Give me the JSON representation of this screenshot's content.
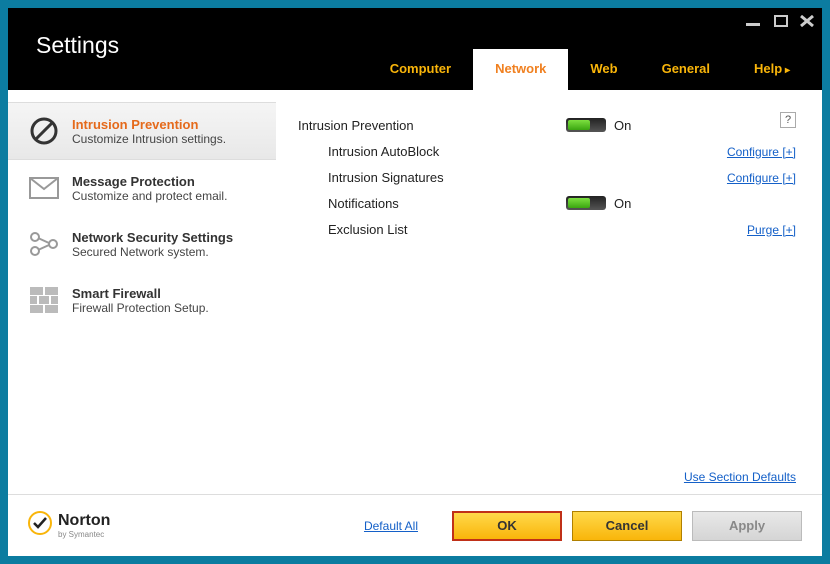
{
  "title": "Settings",
  "tabs": [
    {
      "label": "Computer",
      "active": false
    },
    {
      "label": "Network",
      "active": true
    },
    {
      "label": "Web",
      "active": false
    },
    {
      "label": "General",
      "active": false
    },
    {
      "label": "Help",
      "active": false,
      "help": true
    }
  ],
  "sidebar": [
    {
      "title": "Intrusion Prevention",
      "desc": "Customize Intrusion settings.",
      "icon": "block-icon",
      "active": true
    },
    {
      "title": "Message Protection",
      "desc": "Customize and protect email.",
      "icon": "envelope-icon",
      "active": false
    },
    {
      "title": "Network Security Settings",
      "desc": "Secured Network system.",
      "icon": "network-icon",
      "active": false
    },
    {
      "title": "Smart Firewall",
      "desc": "Firewall Protection Setup.",
      "icon": "firewall-icon",
      "active": false
    }
  ],
  "settings": [
    {
      "label": "Intrusion Prevention",
      "sub": false,
      "toggle": true,
      "state": "On",
      "action": ""
    },
    {
      "label": "Intrusion AutoBlock",
      "sub": true,
      "toggle": false,
      "state": "",
      "action": "Configure [+]"
    },
    {
      "label": "Intrusion Signatures",
      "sub": true,
      "toggle": false,
      "state": "",
      "action": "Configure [+]"
    },
    {
      "label": "Notifications",
      "sub": true,
      "toggle": true,
      "state": "On",
      "action": ""
    },
    {
      "label": "Exclusion List",
      "sub": true,
      "toggle": false,
      "state": "",
      "action": "Purge [+]"
    }
  ],
  "help_icon": "?",
  "section_defaults": "Use Section Defaults",
  "footer": {
    "logo": "Norton",
    "logo_sub": "by Symantec",
    "default_all": "Default All",
    "ok": "OK",
    "cancel": "Cancel",
    "apply": "Apply"
  }
}
